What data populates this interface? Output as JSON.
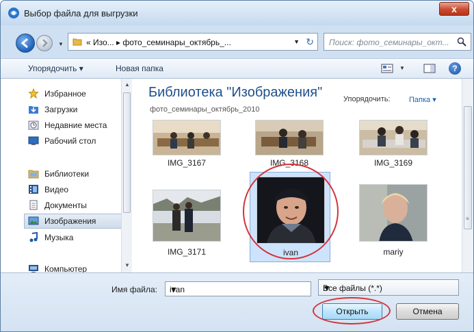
{
  "window": {
    "title": "Выбор файла для выгрузки",
    "close_label": "x"
  },
  "nav": {
    "address_path": "«  Изо...  ▸  фото_семинары_октябрь_...",
    "search_placeholder": "Поиск: фото_семинары_окт..."
  },
  "toolbar": {
    "organize_label": "Упорядочить ▾",
    "new_folder_label": "Новая папка",
    "help_label": "?"
  },
  "sidebar": {
    "items": [
      {
        "label": "Избранное",
        "icon": "star-icon",
        "heading": true
      },
      {
        "label": "Загрузки",
        "icon": "downloads-folder-icon"
      },
      {
        "label": "Недавние места",
        "icon": "recent-places-icon"
      },
      {
        "label": "Рабочий стол",
        "icon": "desktop-icon"
      },
      {
        "label": "Библиотеки",
        "icon": "libraries-icon",
        "heading": true
      },
      {
        "label": "Видео",
        "icon": "video-icon"
      },
      {
        "label": "Документы",
        "icon": "documents-icon"
      },
      {
        "label": "Изображения",
        "icon": "pictures-icon",
        "selected": true
      },
      {
        "label": "Музыка",
        "icon": "music-icon"
      },
      {
        "label": "Компьютер",
        "icon": "computer-icon",
        "heading": true
      }
    ]
  },
  "library": {
    "title": "Библиотека \"Изображения\"",
    "subtitle": "фото_семинары_октябрь_2010",
    "arrange_label": "Упорядочить:",
    "arrange_value": "Папка ▾"
  },
  "files": [
    {
      "name": "IMG_3167"
    },
    {
      "name": "IMG_3168"
    },
    {
      "name": "IMG_3169"
    },
    {
      "name": "IMG_3171"
    },
    {
      "name": "ivan",
      "selected": true
    },
    {
      "name": "mariy"
    }
  ],
  "footer": {
    "filename_label": "Имя файла:",
    "filename_value": "ivan",
    "filetype_value": "Все файлы (*.*)",
    "open_label": "Открыть",
    "cancel_label": "Отмена"
  },
  "colors": {
    "accent": "#1e4f8a",
    "highlight_circle": "#d4323a",
    "selection": "#cde3fb"
  }
}
